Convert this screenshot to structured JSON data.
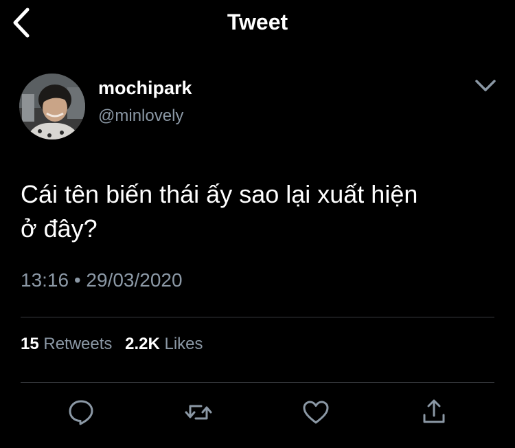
{
  "header": {
    "title": "Tweet",
    "back_icon": "back-chevron-icon"
  },
  "author": {
    "display_name": "mochipark",
    "handle": "@minlovely",
    "more_icon": "chevron-down-icon"
  },
  "tweet": {
    "text_line1": "Cái tên biến thái ấy sao lại xuất hiện",
    "text_line2": "ở đây?",
    "timestamp": "13:16 • 29/03/2020"
  },
  "stats": {
    "retweets_count": "15",
    "retweets_label": "Retweets",
    "likes_count": "2.2K",
    "likes_label": "Likes"
  },
  "actions": [
    {
      "name": "reply",
      "icon": "reply-icon"
    },
    {
      "name": "retweet",
      "icon": "retweet-icon"
    },
    {
      "name": "like",
      "icon": "heart-icon"
    },
    {
      "name": "share",
      "icon": "share-icon"
    }
  ],
  "colors": {
    "background": "#000000",
    "primary_text": "#ffffff",
    "secondary_text": "#8b98a5",
    "divider": "#3a3d41",
    "icon": "#8b98a5"
  }
}
